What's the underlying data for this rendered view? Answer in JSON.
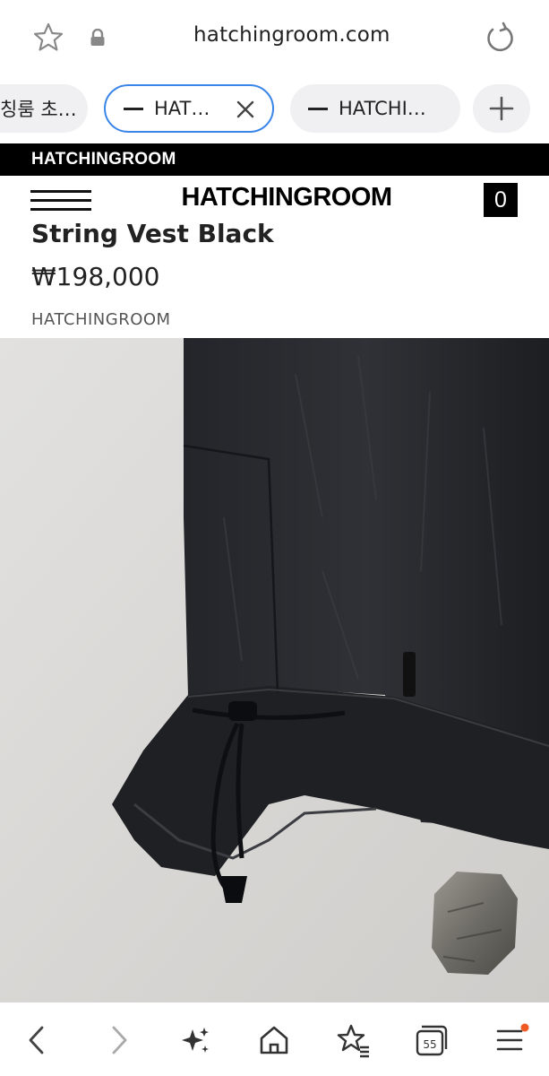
{
  "browser": {
    "url": "hatchingroom.com",
    "tabs": [
      {
        "label": "칭룸 초…"
      },
      {
        "label": "HAT…",
        "active": true
      },
      {
        "label": "HATCHI…"
      }
    ],
    "tab_count": "55",
    "accent_color": "#3a86e8",
    "notification_dot_color": "#f05a22"
  },
  "site": {
    "brand_band": "HATCHINGROOM",
    "logo": "HATCHINGROOM",
    "cart_count": "0"
  },
  "product": {
    "title": "String Vest Black",
    "price": "₩198,000",
    "vendor": "HATCHINGROOM"
  },
  "icons": {
    "bookmark": "star-icon",
    "secure": "lock-icon",
    "reload": "reload-icon",
    "close_tab": "close-icon",
    "new_tab": "plus-icon",
    "menu": "hamburger-icon",
    "back": "chevron-left-icon",
    "forward": "chevron-right-icon",
    "assistant": "sparkle-icon",
    "home": "home-icon",
    "bookmarks": "star-list-icon",
    "tabs": "tabs-icon",
    "browser_menu": "menu-icon"
  }
}
